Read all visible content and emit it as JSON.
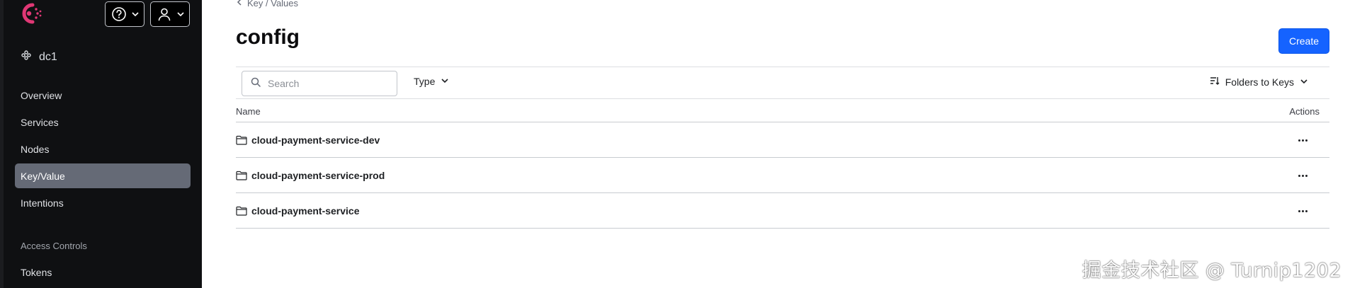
{
  "sidebar": {
    "datacenter": "dc1",
    "nav": [
      {
        "label": "Overview",
        "active": false
      },
      {
        "label": "Services",
        "active": false
      },
      {
        "label": "Nodes",
        "active": false
      },
      {
        "label": "Key/Value",
        "active": true
      },
      {
        "label": "Intentions",
        "active": false
      }
    ],
    "section_heading": "Access Controls",
    "section_items": [
      {
        "label": "Tokens"
      }
    ]
  },
  "header": {
    "breadcrumb": "Key / Values",
    "title": "config",
    "create_label": "Create"
  },
  "toolbar": {
    "search_placeholder": "Search",
    "type_label": "Type",
    "sort_label": "Folders to Keys"
  },
  "table": {
    "columns": {
      "name": "Name",
      "actions": "Actions"
    },
    "rows": [
      {
        "name": "cloud-payment-service-dev"
      },
      {
        "name": "cloud-payment-service-prod"
      },
      {
        "name": "cloud-payment-service"
      }
    ]
  },
  "watermark": "掘金技术社区 @ Turnip1202",
  "colors": {
    "sidebar_bg": "#0f1012",
    "active_nav_bg": "#656a76",
    "brand": "#e03875",
    "primary_button": "#1563ff"
  }
}
